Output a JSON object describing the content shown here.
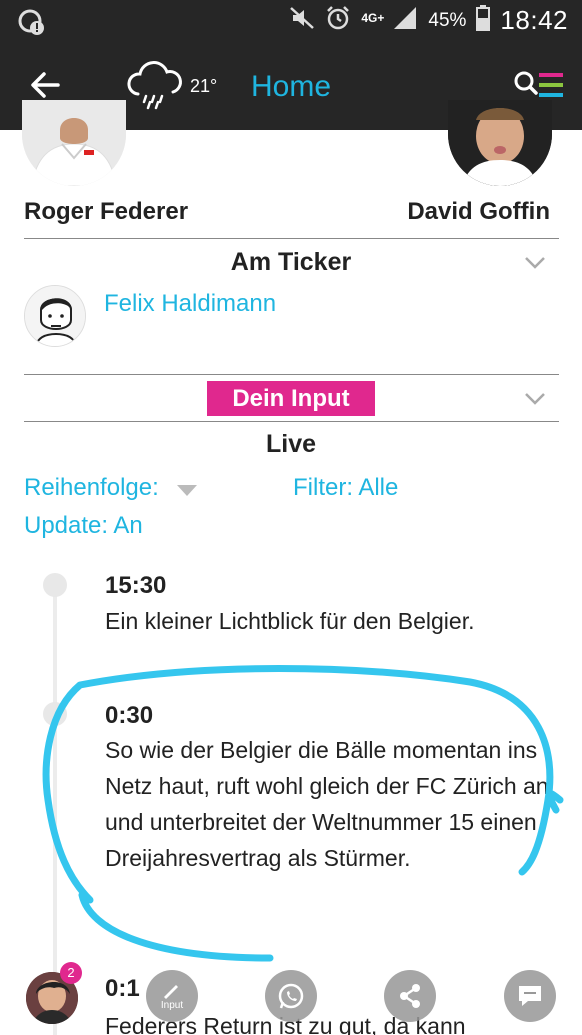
{
  "status_bar": {
    "network": "4G+",
    "battery": "45%",
    "time": "18:42"
  },
  "app_bar": {
    "temperature": "21°",
    "title": "Home",
    "accent_color": "#1fb5e0"
  },
  "match": {
    "player_left": "Roger Federer",
    "player_right": "David Goffin"
  },
  "ticker": {
    "title": "Am Ticker",
    "reporter": "Felix Haldimann"
  },
  "input_section": {
    "button_label": "Dein Input",
    "button_color": "#e0288e"
  },
  "live": {
    "title": "Live",
    "order_label": "Reihenfolge:",
    "filter_label": "Filter: Alle",
    "update_label": "Update: An"
  },
  "entries": [
    {
      "time": "15:30",
      "text": "Ein kleiner Lichtblick für den Belgier."
    },
    {
      "time": "0:30",
      "text": "So wie der Belgier die Bälle momentan ins Netz haut, ruft wohl gleich der FC Zürich an und unterbreitet der Weltnummer 15 einen Dreijahresvertrag als Stürmer."
    },
    {
      "time": "0:1",
      "text": "Federers Return ist zu gut, da kann"
    }
  ],
  "bottom_bar": {
    "notification_count": "2",
    "input_label": "Input"
  }
}
